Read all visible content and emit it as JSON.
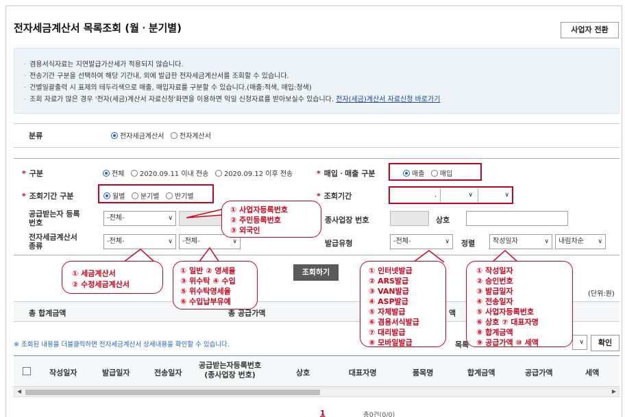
{
  "page": {
    "title": "전자세금계산서 목록조회 (월ㆍ분기별)",
    "switch_button": "사업자 전환"
  },
  "notice": {
    "lines": [
      "겸용서식자료는 지연발급가산세가 적용되지 않습니다.",
      "전송기간 구분을 선택하여 해당 기간내, 외에 발급한 전자세금계산서를 조회할 수 있습니다.",
      "건별일괄출력 시 표제의 테두리색으로 매출, 매입자료를 구분할 수 있습니다.(매출:적색, 매입:청색)",
      "조회 자료가 많은 경우 '전자(세금)계산서 자료신청'화면을 이용하면 익일 신청자료를 받아보실수 있습니다."
    ],
    "link": "전자(세금)계산서 자료신청 바로가기"
  },
  "category": {
    "label": "분류",
    "options": [
      "전자세금계산서",
      "전자계산서"
    ],
    "selected": 0
  },
  "form": {
    "gubun_label": "구분",
    "gubun_options": [
      "전체",
      "2020.09.11 이내 전송",
      "2020.09.12 이후 전송"
    ],
    "trade_label": "매입ㆍ매출 구분",
    "trade_options": [
      "매출",
      "매입"
    ],
    "period_type_label": "조회기간 구분",
    "period_type_options": [
      "월별",
      "분기별",
      "반기별"
    ],
    "period_label": "조회기간",
    "period_separator": ",",
    "receiver_label_1": "공급받는자 등록",
    "receiver_label_2": "번호",
    "receiver_select": "-전체-",
    "sub_biz_label": "종사업장 번호",
    "company_label": "상호",
    "invoice_type_label_1": "전자세금계산서",
    "invoice_type_label_2": "종류",
    "invoice_type_select": "-전체-",
    "invoice_subtype_select": "-전체-",
    "issue_type_label": "발급유형",
    "issue_type_select": "-전체-",
    "sort_label": "정렬",
    "sort_field": "작성일자",
    "sort_order": "내림차순",
    "search_button": "조회하기"
  },
  "bubbles": {
    "receiver": [
      "① 사업자등록번호",
      "② 주민등록번호",
      "③ 외국인"
    ],
    "invoice_type": [
      "① 세금계산서",
      "② 수정세금계산서"
    ],
    "invoice_subtype": [
      "① 일반 ② 영세율",
      "③ 위수탁 ④ 수입",
      "⑤ 위수탁영세율",
      "⑥ 수입납부유예"
    ],
    "issue_type": [
      "① 인터넷발급",
      "② ARS발급",
      "③ VAN발급",
      "④ ASP발급",
      "⑤ 자체발급",
      "⑥ 겸용서식발급",
      "⑦ 대리발급",
      "⑧ 모바일발급"
    ],
    "sort_field": [
      "① 작성일자",
      "② 승인번호",
      "③ 발급일자",
      "④ 전송일자",
      "⑤ 사업자등록번호",
      "⑥ 상호 ⑦ 대표자명",
      "⑧ 합계금액",
      "⑨ 공급가액 ⑩ 세액"
    ]
  },
  "summary": {
    "unit": "(단위:원)",
    "total_label": "총 합계금액",
    "supply_label": "총 공급가액",
    "tax_label": "액"
  },
  "list": {
    "notice": "※ 조회된 내용을 더블클릭하면 전자세금계산서 상세내용을 확인할 수 있습니다.",
    "rows_label": "목록",
    "confirm_button": "확인",
    "columns": [
      "작성일자",
      "발급일자",
      "전송일자",
      "공급받는자등록번호",
      "(종사업장 번호)",
      "상호",
      "대표자명",
      "품목명",
      "합계금액",
      "공급가액",
      "세액"
    ]
  },
  "pagination": {
    "current": "1",
    "total_text": "총0건(0/0)"
  },
  "colors": {
    "accent_blue": "#1a5fd0",
    "highlight_red": "#c8001e",
    "notice_bg": "#eef3f8"
  }
}
